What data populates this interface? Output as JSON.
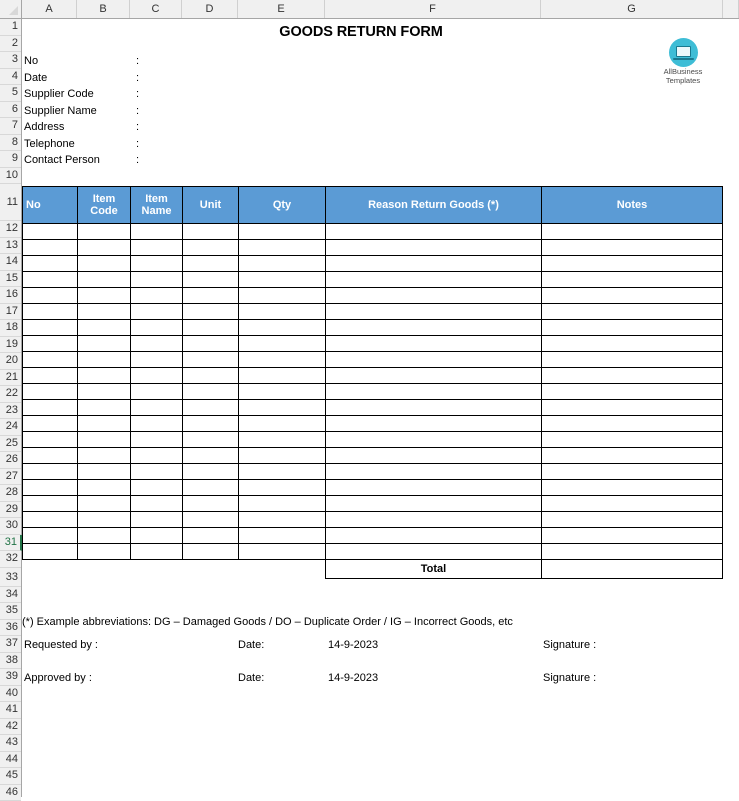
{
  "app": {
    "type": "spreadsheet",
    "accent_blue": "#5b9bd5",
    "active_row_color": "#217346",
    "logo_color": "#3ebdd6"
  },
  "grid": {
    "column_letters": [
      "A",
      "B",
      "C",
      "D",
      "E",
      "F",
      "G"
    ],
    "row_numbers": [
      1,
      2,
      3,
      4,
      5,
      6,
      7,
      8,
      9,
      10,
      11,
      12,
      13,
      14,
      15,
      16,
      17,
      18,
      19,
      20,
      21,
      22,
      23,
      24,
      25,
      26,
      27,
      28,
      29,
      30,
      31,
      32,
      33,
      34,
      35,
      36,
      37,
      38,
      39,
      40,
      41,
      42,
      43,
      44,
      45,
      46
    ],
    "active_row": 31
  },
  "document": {
    "title": "GOODS RETURN FORM",
    "logo": {
      "icon": "laptop-icon",
      "line1": "AllBusiness",
      "line2": "Templates"
    },
    "header_fields": [
      {
        "label": "No",
        "separator": ":",
        "value": ""
      },
      {
        "label": "Date",
        "separator": ":",
        "value": ""
      },
      {
        "label": "Supplier Code",
        "separator": ":",
        "value": ""
      },
      {
        "label": "Supplier Name",
        "separator": ":",
        "value": ""
      },
      {
        "label": "Address",
        "separator": ":",
        "value": ""
      },
      {
        "label": "Telephone",
        "separator": ":",
        "value": ""
      },
      {
        "label": "Contact Person",
        "separator": ":",
        "value": ""
      }
    ],
    "table": {
      "columns": [
        {
          "label": "No",
          "align": "left"
        },
        {
          "label": "Item Code",
          "align": "center"
        },
        {
          "label": "Item Name",
          "align": "center"
        },
        {
          "label": "Unit",
          "align": "center"
        },
        {
          "label": "Qty",
          "align": "center"
        },
        {
          "label": "Reason Return Goods (*)",
          "align": "center"
        },
        {
          "label": "Notes",
          "align": "center"
        }
      ],
      "data_row_count": 21,
      "total_label": "Total",
      "total_value": ""
    },
    "footnote": "(*) Example abbreviations: DG – Damaged Goods / DO – Duplicate Order / IG – Incorrect Goods, etc",
    "signatures": [
      {
        "role_label": "Requested by :",
        "date_label": "Date:",
        "date_value": "14-9-2023",
        "signature_label": "Signature :"
      },
      {
        "role_label": "Approved by :",
        "date_label": "Date:",
        "date_value": "14-9-2023",
        "signature_label": "Signature :"
      }
    ]
  }
}
